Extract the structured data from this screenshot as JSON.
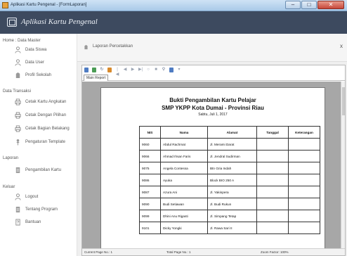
{
  "window": {
    "title": "Aplikasi Kartu Pengenal - [FormLaporan]"
  },
  "header": {
    "app_title": "Aplikasi Kartu Pengenal"
  },
  "sidebar": {
    "sections": [
      {
        "label": "Home : Data Master",
        "items": [
          {
            "label": "Data Siswa",
            "icon": "user-icon"
          },
          {
            "label": "Data User",
            "icon": "user-icon"
          },
          {
            "label": "Profil Sekolah",
            "icon": "building-icon"
          }
        ]
      },
      {
        "label": "Data Transaksi",
        "items": [
          {
            "label": "Cetak Kartu Angkatan",
            "icon": "printer-icon"
          },
          {
            "label": "Cetak Dengan Pilihan",
            "icon": "printer-icon"
          },
          {
            "label": "Cetak Bagian Belakang",
            "icon": "printer-icon"
          },
          {
            "label": "Pengaturan Template",
            "icon": "pin-icon"
          }
        ]
      },
      {
        "label": "Laporan",
        "items": [
          {
            "label": "Pengambilan Kartu",
            "icon": "document-icon"
          }
        ]
      },
      {
        "label": "Keluar",
        "items": [
          {
            "label": "Logout",
            "icon": "user-icon"
          },
          {
            "label": "Tentang Program",
            "icon": "document-icon"
          },
          {
            "label": "Bantuan",
            "icon": "help-document-icon"
          }
        ]
      }
    ]
  },
  "panel": {
    "title": "Laporan Percetakkan",
    "close": "x"
  },
  "viewer": {
    "tab": "Main Report",
    "status": {
      "current_page": "Current Page No.: 1",
      "total_page": "Total Page No.: 1",
      "zoom": "Zoom Factor: 100%"
    }
  },
  "report": {
    "title": "Bukti Pengambilan Kartu Pelajar",
    "subtitle": "SMP YKPP Kota Dumai - Provinsi Riau",
    "date": "Sabtu, Juli 1, 2017",
    "columns": [
      "NIS",
      "Nama",
      "Alamat",
      "Tanggal",
      "Keterangan"
    ],
    "rows": [
      [
        "9060",
        "Abdul Rachmat",
        "Jl. Merami Darat",
        "",
        ""
      ],
      [
        "9066",
        "Ahmad Ihsan Faris",
        "Jl. Jendral Sudirman",
        "",
        ""
      ],
      [
        "9075",
        "Angela Contessa",
        "Btn Gria Indah",
        "",
        ""
      ],
      [
        "9086",
        "Ayuka",
        "Block BIO 250 A",
        "",
        ""
      ],
      [
        "9087",
        "Azura Ani",
        "Jl. Yakinpera",
        "",
        ""
      ],
      [
        "9090",
        "Budi Setiawan",
        "Jl. Budi Rukun",
        "",
        ""
      ],
      [
        "9099",
        "Dhini Anu Rigasti",
        "Jl. Simpang Tetap",
        "",
        ""
      ],
      [
        "9101",
        "Dicky Yongki",
        "Jl. Rawa Sari II",
        "",
        ""
      ]
    ]
  }
}
